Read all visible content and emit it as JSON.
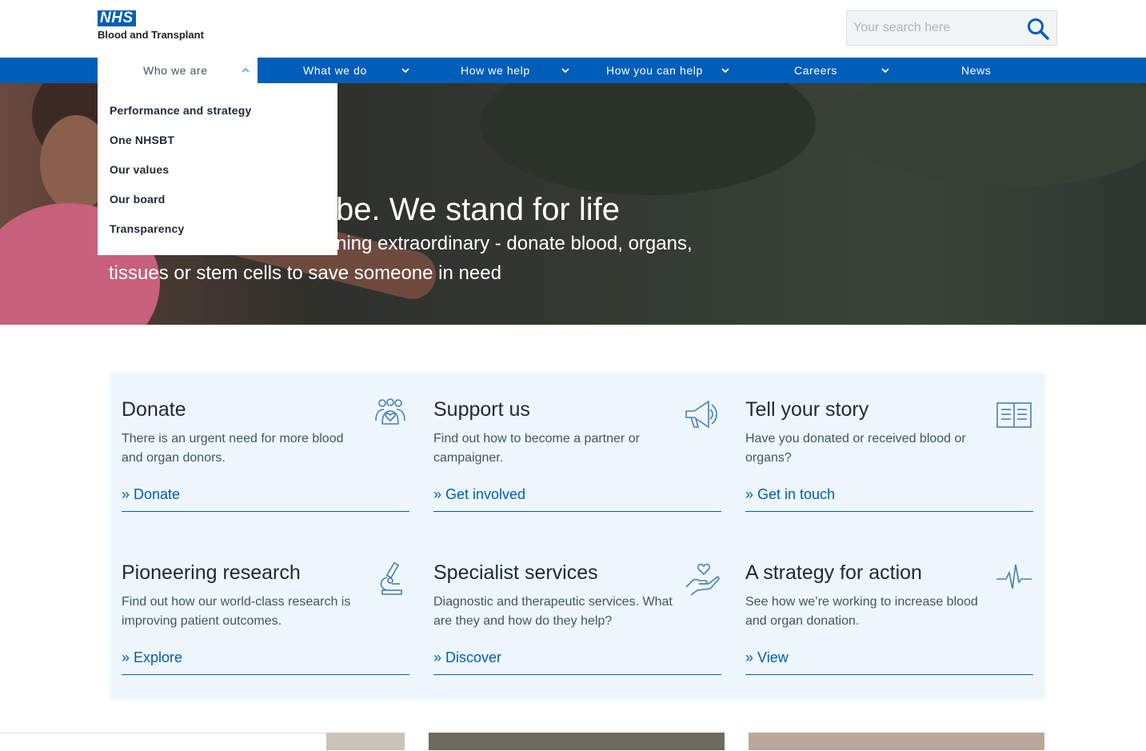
{
  "header": {
    "logo_badge": "NHS",
    "logo_org": "Blood and Transplant",
    "search_placeholder": "Your search here"
  },
  "nav": [
    {
      "label": "Who we are"
    },
    {
      "label": "What we do"
    },
    {
      "label": "How we help"
    },
    {
      "label": "How you can help"
    },
    {
      "label": "Careers"
    },
    {
      "label": "News"
    }
  ],
  "dropdown": [
    {
      "label": "Performance and strategy"
    },
    {
      "label": "One NHSBT"
    },
    {
      "label": "Our values"
    },
    {
      "label": "Our board"
    },
    {
      "label": "Transparency"
    }
  ],
  "hero": {
    "title_visible": "be. We stand for life",
    "subtitle_visible": "ning extraordinary - donate blood, organs, tissues or stem cells to save someone in need"
  },
  "cards": [
    {
      "title": "Donate",
      "text": "There is an urgent need for more blood and organ donors.",
      "link": "Donate",
      "icon": "people-heart-icon"
    },
    {
      "title": "Support us",
      "text": "Find out how to become a partner or campaigner.",
      "link": "Get involved",
      "icon": "megaphone-icon"
    },
    {
      "title": "Tell your story",
      "text": "Have you donated or received blood or organs?",
      "link": "Get in touch",
      "icon": "open-book-icon"
    },
    {
      "title": "Pioneering research",
      "text": "Find out how our world-class research is improving patient outcomes.",
      "link": "Explore",
      "icon": "microscope-icon"
    },
    {
      "title": "Specialist services",
      "text": "Diagnostic and therapeutic services. What are they and how do they help?",
      "link": "Discover",
      "icon": "hand-heart-icon"
    },
    {
      "title": "A strategy for action",
      "text": "See how we’re working to increase blood and organ donation.",
      "link": "View",
      "icon": "heartbeat-icon"
    }
  ],
  "colors": {
    "primary_blue": "#005eb8",
    "card_bg": "#eef7fd",
    "text_dark": "#212b32",
    "text_secondary": "#425563"
  }
}
